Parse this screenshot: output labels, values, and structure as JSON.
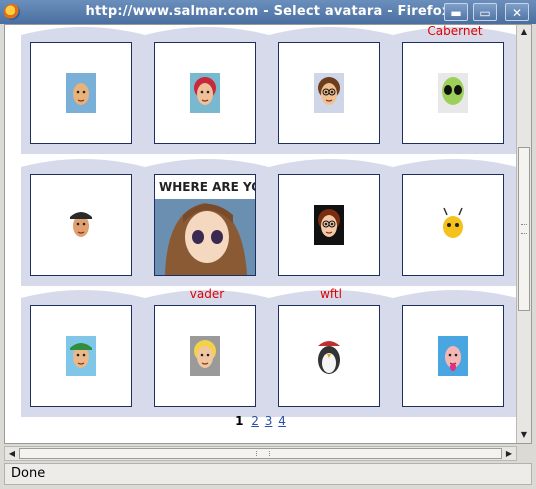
{
  "window": {
    "title": "http://www.salmar.com - Select avatara - Firefox",
    "minimize_label": "▬",
    "maximize_label": "▭",
    "close_label": "✕"
  },
  "avatars": [
    {
      "label": "",
      "icon": "bald-man-avatar-icon"
    },
    {
      "label": "",
      "icon": "red-haired-woman-avatar-icon"
    },
    {
      "label": "",
      "icon": "glasses-man-avatar-icon"
    },
    {
      "label": "Cabernet",
      "icon": "alien-avatar-icon"
    },
    {
      "label": "",
      "icon": "pirate-avatar-icon"
    },
    {
      "label": "",
      "icon": "anime-girl-avatar-icon",
      "caption": "WHERE ARE YOU going?"
    },
    {
      "label": "",
      "icon": "brown-haired-woman-avatar-icon"
    },
    {
      "label": "",
      "icon": "bee-avatar-icon"
    },
    {
      "label": "",
      "icon": "elf-avatar-icon"
    },
    {
      "label": "vader",
      "icon": "blonde-boy-avatar-icon"
    },
    {
      "label": "wftl",
      "icon": "penguin-avatar-icon"
    },
    {
      "label": "",
      "icon": "baby-avatar-icon"
    }
  ],
  "pagination": {
    "current": "1",
    "pages": [
      "2",
      "3",
      "4"
    ]
  },
  "status": {
    "text": "Done"
  },
  "colors": {
    "label_red": "#e00000",
    "link_blue": "#2a4fa8",
    "cell_shade": "#d6daea",
    "box_border": "#1d2f5e"
  }
}
